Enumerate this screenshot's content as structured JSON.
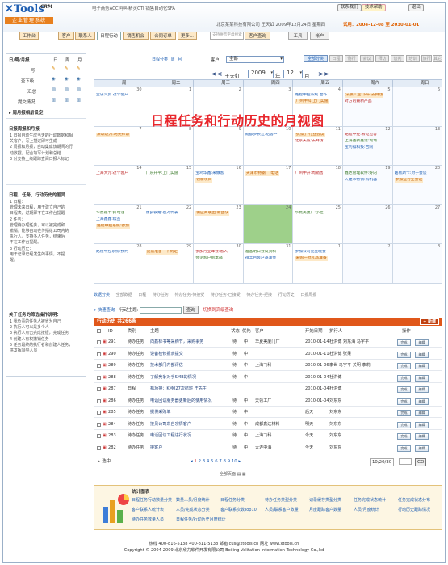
{
  "app": {
    "logo_text": "Tools",
    "logo_crm": "CRM",
    "logo_cn": "企业管理系统",
    "promo": "电子商务ACC  呼叫精灵CTI  销售自动化SFA",
    "btn_help": "联系我们",
    "btn_contact": "技术帮助",
    "btn_logout": "退出"
  },
  "userinfo": {
    "company": "北京某某科技有限公司",
    "user": "王天虹",
    "date": "2009年12月24日",
    "expire_label": "星期四",
    "trial": "试用：2004-12-08 至 2030-01-01"
  },
  "modules": [
    "工作台",
    "客户",
    "联系人",
    "日程行动",
    "销售机会",
    "合同订单",
    "更多..."
  ],
  "search": {
    "placeholder": "支持拼音字母搜索",
    "button": "客户查询"
  },
  "tools": [
    "工具",
    "帐户"
  ],
  "sidebar": {
    "mini_head": [
      "日/周/月报",
      "日",
      "周",
      "月"
    ],
    "mini_rows": [
      "写",
      "查下级",
      "汇总",
      "提交情况"
    ],
    "link": "周月报相册设定",
    "sec1_title": "日报周报和月报",
    "sec1_lines": [
      "1 日报自动生成当天的行动数据和相",
      "  关客户，写上描述即可生成",
      "2 周报和月报，自动集成该期间的行",
      "  动数据，配合填写计划和总结",
      "3 对支持上级跟踪查阅日报人标记"
    ],
    "sec2_title": "日程、任务、行动历史的差异",
    "sec2_lines": [
      "1 日程：",
      "  管理未来日程，用于建立自己的",
      "  日程表，过期即不在工作台提醒",
      "2 任务：",
      "  管理待办理任务，可以被完成和",
      "  撤销，能够自动在传播给公司内的",
      "  执行人，支持多人任务，结束后",
      "  不在工作台提醒。",
      "3 行动历史：",
      "  用于记录已经发生的事情，不提",
      "  醒。"
    ],
    "sec3_title": "关于任务的筛选操作说明：",
    "sec3_lines": [
      "1 我负责的任务人被省为自己",
      "2 执行人可以是多个人",
      "3 执行人点击完成按钮，完成任务",
      "4 创建人有权撤销任务",
      "5 任务最终的执行者和创建人任务，",
      "  供发挥领导人员"
    ]
  },
  "calendar": {
    "tabs": [
      "日程分类",
      "周",
      "月"
    ],
    "customer_label": "客户:",
    "customer_value": "全部",
    "user": "王天虹",
    "year": "2009",
    "year_unit": "年",
    "month": "12",
    "month_unit": "月",
    "nav_prev": "<<",
    "nav_next": ">>",
    "cats": [
      "全部分类",
      "日程",
      "例行",
      "会议",
      "拜访",
      "谈判",
      "培训",
      "旅行",
      "其它"
    ],
    "weekdays": [
      "周一",
      "周二",
      "周三",
      "周四",
      "周五",
      "周六",
      "周日"
    ],
    "title_overlay": "日程任务和行动历史的月视图",
    "days": [
      [
        "30",
        "1",
        "2",
        "3",
        "4",
        "5",
        "6"
      ],
      [
        "7",
        "8",
        "9",
        "10",
        "11",
        "12",
        "13"
      ],
      [
        "14",
        "15",
        "16",
        "17",
        "18",
        "19",
        "20"
      ],
      [
        "21",
        "22",
        "23",
        "24",
        "25",
        "26",
        "27"
      ],
      [
        "28",
        "29",
        "30",
        "31",
        "1",
        "2",
        "3"
      ]
    ],
    "events": {
      "r0c0": [
        "宝乐汽贸 过个客户"
      ],
      "r0c4": [
        "路程中控系统 合作",
        "广州中科:上门实施"
      ],
      "r0c5": [
        "法联工业:下午 去拜访",
        "对方的最新产品"
      ],
      "r1c0": [
        "深圳达力:明天拜访"
      ],
      "r1c3": [
        "成都多长江:给客户"
      ],
      "r1c4": [
        "参加了 行业会议",
        "北京天威:去拜访"
      ],
      "r1c5": [
        "路程中控:去见见客",
        "上海鑫新鑫达:现场",
        "宝利得科技:合同"
      ],
      "r2c0": [
        "上海大元:过个客户"
      ],
      "r2c1": [
        "广东开平:上门实施"
      ],
      "r2c2": [
        "宝鸡华鑫:来做客",
        "领新项目"
      ],
      "r2c3": [
        "天津市特钢厂:电话"
      ],
      "r2c4": [
        "广州中升:周销售"
      ],
      "r2c5": [
        "鑫达管理软件:好的",
        "天建市特钢:购机器"
      ],
      "r2c6": [
        "路易斯卡:对于会谈",
        "参加些行业会议"
      ],
      "r3c0": [
        "华鼎德丰:打电话",
        "上海鑫鑫:续签",
        "路程中控系统:参加"
      ],
      "r3c1": [
        "康良铁路:也对代表"
      ],
      "r3c2": [
        "供应商联盟:新团队"
      ],
      "r3c4": [
        "华夏美巢厂:小杜"
      ],
      "r4c0": [
        "路程中控系统:预约"
      ],
      "r4c1": [
        "提前准备一下制定"
      ],
      "r4c2": [
        "参加行业峰会:客人",
        "会见客户到本部"
      ],
      "r4c3": [
        "准备明日会议资料",
        "祥丰月客户基准会"
      ],
      "r4c4": [
        "参加公司元旦晚会",
        "采购一批礼品准备"
      ]
    }
  },
  "legend": [
    "数据分类",
    "全部数据",
    "日程",
    "待办任务",
    "待办任务-待接受",
    "待办任务-已接受",
    "待办任务-拒接",
    "行动历史",
    "日报周报"
  ],
  "quicksearch": {
    "label": "快速查询",
    "field_label": "行动主题:",
    "button": "查询",
    "link": "切换到高级查询"
  },
  "list": {
    "title": "行动历史  共266条",
    "new_button": "+ 新建",
    "headers": [
      "ID",
      "类别",
      "主题",
      "状态",
      "优先",
      "客户",
      "开始日期",
      "执行人",
      "操作"
    ],
    "rows": [
      [
        "291",
        "待办任务",
        "向鑫标书等采购节，采购事务",
        "待",
        "中",
        "华夏美厦门厂",
        "2010-01-14",
        "杜洪博 刘东海 马宇平"
      ],
      [
        "290",
        "待办任务",
        "设备检修报表提交",
        "待",
        "中",
        "",
        "2010-01-11",
        "杜洪博 张果"
      ],
      [
        "289",
        "待办任务",
        "技术部门内部评估",
        "待",
        "中",
        "上海飞科",
        "2010-01-06",
        "李世 马宇平 关明 李莉"
      ],
      [
        "288",
        "待办任务",
        "了解竞争对手SMB的情况",
        "待",
        "中",
        "",
        "2010-01-04",
        "杜洪博"
      ],
      [
        "287",
        "日程",
        "机场接：KM027次航班 王先生",
        "",
        "",
        "",
        "2010-01-04",
        "杜洪博"
      ],
      [
        "286",
        "待办任务",
        "电话回访服务器更新后的使用情况",
        "待",
        "中",
        "天领工厂",
        "2010-01-04",
        "刘东东"
      ],
      [
        "285",
        "待办任务",
        "提供采购单",
        "待",
        "中",
        "",
        "后天",
        "刘东东"
      ],
      [
        "284",
        "待办任务",
        "接见公司来自宗情客户",
        "待",
        "中",
        "成都鑫达材料",
        "明天",
        "刘东东"
      ],
      [
        "283",
        "待办任务",
        "电话回访工程进行状况",
        "待",
        "中",
        "上海飞科",
        "今天",
        "刘东东"
      ],
      [
        "282",
        "待办任务",
        "接客户",
        "待",
        "中",
        "大连中海",
        "今天",
        "刘东东"
      ]
    ],
    "op_done": "完成",
    "op_edit": "编辑"
  },
  "pager": {
    "select_label": "选中",
    "pages": [
      "1",
      "2",
      "3",
      "4",
      "5",
      "6",
      "7",
      "8",
      "9",
      "10"
    ],
    "per_page": "10/20/30",
    "go": "GO",
    "all_label": "全部页面"
  },
  "stats": {
    "title": "统计图表",
    "items": [
      "日程任务行动数量分类",
      "数量人员/月度统计",
      "日程任务分类",
      "待办任务类型分类",
      "记录缓存类型分类",
      "任务完成状态统计",
      "任务完成状态分布",
      "客户联系人统计表",
      "人员/完成状态分类",
      "客户联系次数Top10",
      "人员/联系客户数量",
      "月度跟踪客户数量",
      "人员/月度统计",
      "行动历史跟踪情况",
      "待办任务数量人员",
      "日程任务/行动历史月度统计"
    ]
  },
  "footer": {
    "line1": "热线 400-816-5138  400-811-5138  邮箱 cus@xtools.cn  网址 www.xtools.cn",
    "line2": "Copyright © 2004-2009  北京欣力软件开发有限公司  Beijing Volitation Information Technology Co.,ltd"
  }
}
